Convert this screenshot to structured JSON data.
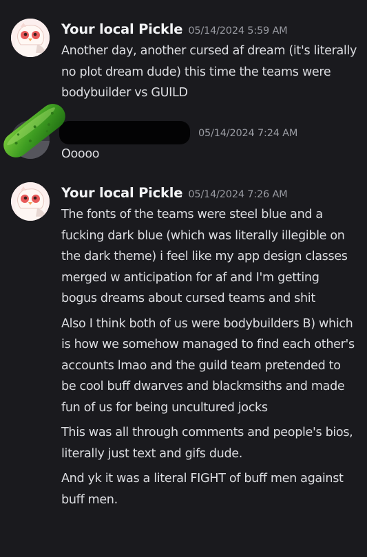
{
  "messages": [
    {
      "username": "Your local Pickle",
      "timestamp": "05/14/2024 5:59 AM",
      "lines": [
        "Another day, another cursed af dream (it's literally no plot dream dude) this time the teams were bodybuilder vs GUILD"
      ]
    },
    {
      "username": "",
      "timestamp": "05/14/2024 7:24 AM",
      "lines": [
        "Ooooo"
      ]
    },
    {
      "username": "Your local Pickle",
      "timestamp": "05/14/2024 7:26 AM",
      "lines": [
        "The fonts of the teams were steel blue and a fucking dark blue (which was literally illegible on the dark theme) i feel like my app design classes merged w anticipation for af and I'm getting bogus dreams about cursed teams and shit",
        "Also I think both of us were bodybuilders B) which is how we somehow managed to find each other's accounts lmao and the guild team pretended to be cool buff dwarves and blackmsiths and made fun of us for being uncultured jocks",
        "This was all through comments and people's bios, literally just text and gifs dude.",
        "And yk it was a literal FIGHT of buff men against buff men."
      ]
    }
  ],
  "icons": {
    "avatar1": "pickle-bird-avatar",
    "avatar2": "redacted-avatar",
    "overlay": "cucumber-sticker"
  },
  "colors": {
    "background": "#1a1a1e",
    "username": "#f2f3f5",
    "timestamp": "#9a9ca3",
    "text": "#dcdde1",
    "pickle_green": "#3fa12a"
  }
}
